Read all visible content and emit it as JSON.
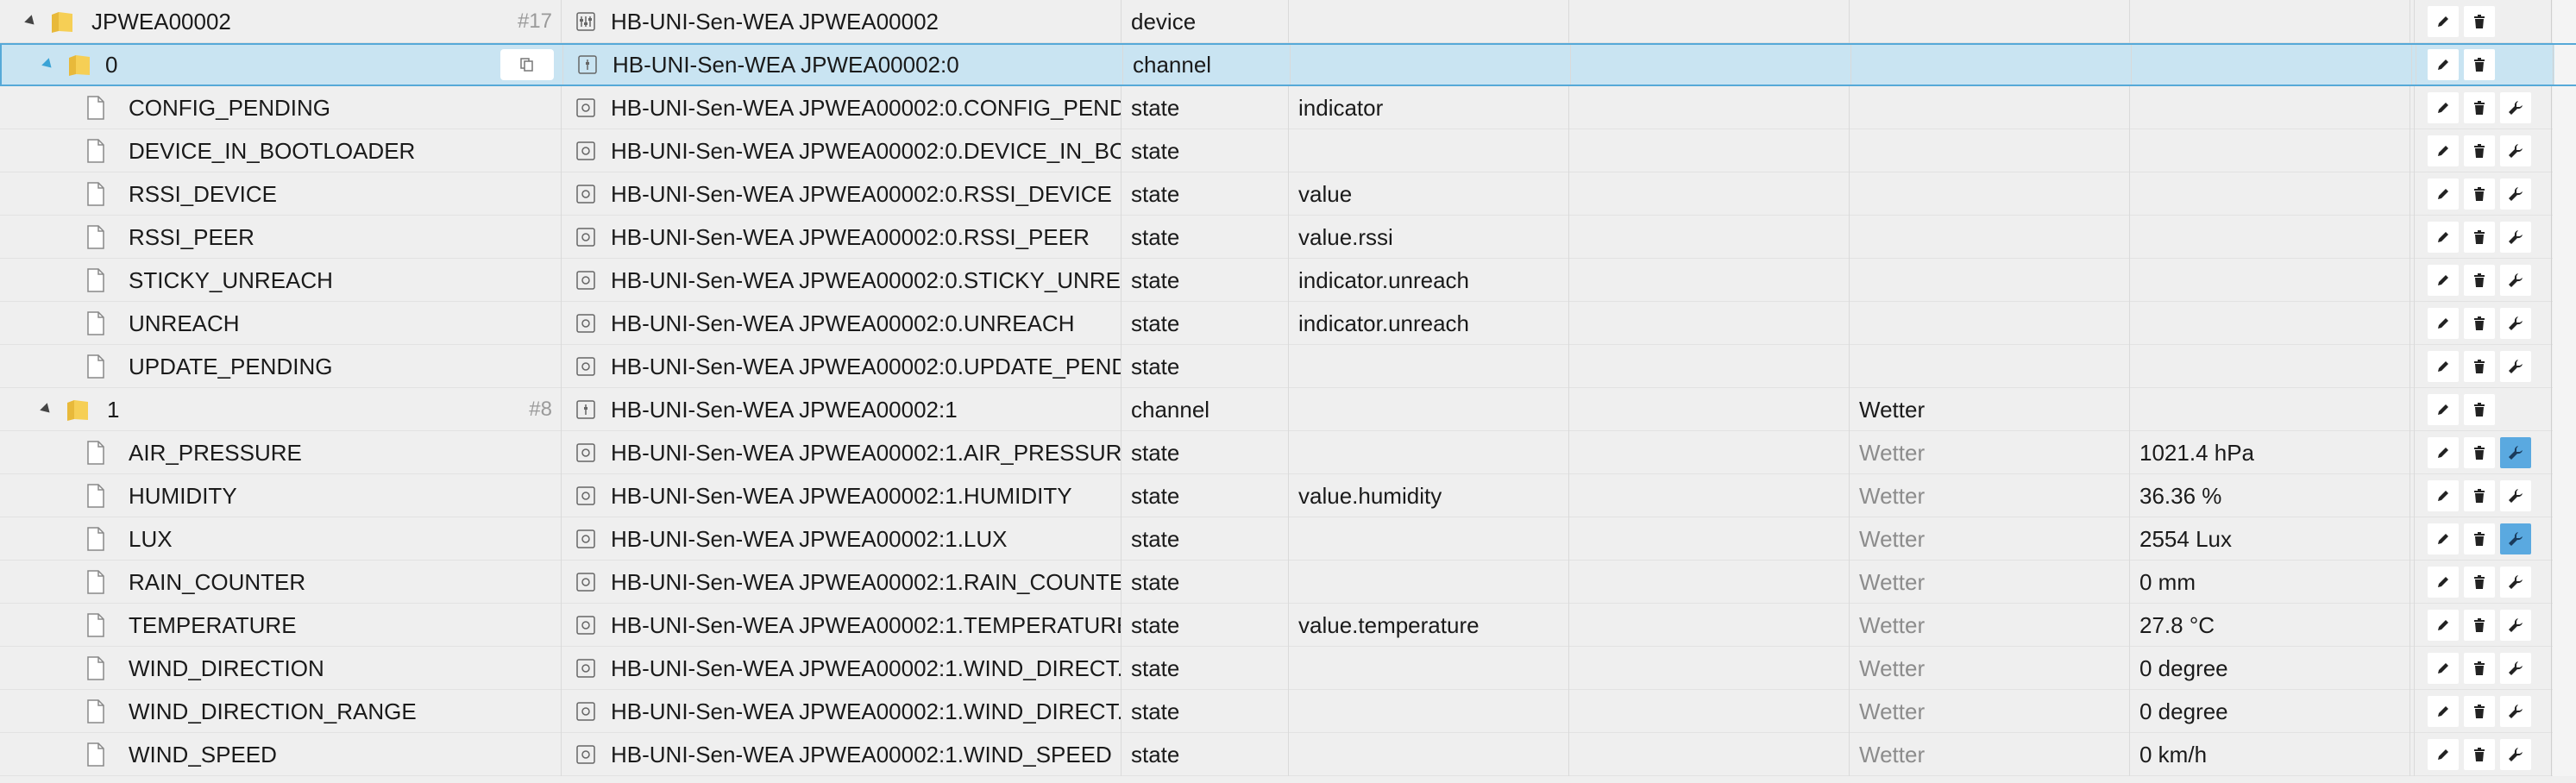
{
  "rows": [
    {
      "name": "JPWEA00002",
      "count": "#17",
      "title": "HB-UNI-Sen-WEA JPWEA00002",
      "type": "device",
      "role": "",
      "function": "",
      "value": ""
    },
    {
      "name": "0",
      "count": "",
      "title": "HB-UNI-Sen-WEA JPWEA00002:0",
      "type": "channel",
      "role": "",
      "function": "",
      "value": ""
    },
    {
      "name": "CONFIG_PENDING",
      "count": "",
      "title": "HB-UNI-Sen-WEA JPWEA00002:0.CONFIG_PEND...",
      "type": "state",
      "role": "indicator",
      "function": "",
      "value": ""
    },
    {
      "name": "DEVICE_IN_BOOTLOADER",
      "count": "",
      "title": "HB-UNI-Sen-WEA JPWEA00002:0.DEVICE_IN_BO...",
      "type": "state",
      "role": "",
      "function": "",
      "value": ""
    },
    {
      "name": "RSSI_DEVICE",
      "count": "",
      "title": "HB-UNI-Sen-WEA JPWEA00002:0.RSSI_DEVICE",
      "type": "state",
      "role": "value",
      "function": "",
      "value": ""
    },
    {
      "name": "RSSI_PEER",
      "count": "",
      "title": "HB-UNI-Sen-WEA JPWEA00002:0.RSSI_PEER",
      "type": "state",
      "role": "value.rssi",
      "function": "",
      "value": ""
    },
    {
      "name": "STICKY_UNREACH",
      "count": "",
      "title": "HB-UNI-Sen-WEA JPWEA00002:0.STICKY_UNRE...",
      "type": "state",
      "role": "indicator.unreach",
      "function": "",
      "value": ""
    },
    {
      "name": "UNREACH",
      "count": "",
      "title": "HB-UNI-Sen-WEA JPWEA00002:0.UNREACH",
      "type": "state",
      "role": "indicator.unreach",
      "function": "",
      "value": ""
    },
    {
      "name": "UPDATE_PENDING",
      "count": "",
      "title": "HB-UNI-Sen-WEA JPWEA00002:0.UPDATE_PEND...",
      "type": "state",
      "role": "",
      "function": "",
      "value": ""
    },
    {
      "name": "1",
      "count": "#8",
      "title": "HB-UNI-Sen-WEA JPWEA00002:1",
      "type": "channel",
      "role": "",
      "function": "Wetter",
      "value": ""
    },
    {
      "name": "AIR_PRESSURE",
      "count": "",
      "title": "HB-UNI-Sen-WEA JPWEA00002:1.AIR_PRESSURE",
      "type": "state",
      "role": "",
      "function": "Wetter",
      "value": "1021.4 hPa"
    },
    {
      "name": "HUMIDITY",
      "count": "",
      "title": "HB-UNI-Sen-WEA JPWEA00002:1.HUMIDITY",
      "type": "state",
      "role": "value.humidity",
      "function": "Wetter",
      "value": "36.36 %"
    },
    {
      "name": "LUX",
      "count": "",
      "title": "HB-UNI-Sen-WEA JPWEA00002:1.LUX",
      "type": "state",
      "role": "",
      "function": "Wetter",
      "value": "2554 Lux"
    },
    {
      "name": "RAIN_COUNTER",
      "count": "",
      "title": "HB-UNI-Sen-WEA JPWEA00002:1.RAIN_COUNTER",
      "type": "state",
      "role": "",
      "function": "Wetter",
      "value": "0 mm"
    },
    {
      "name": "TEMPERATURE",
      "count": "",
      "title": "HB-UNI-Sen-WEA JPWEA00002:1.TEMPERATURE",
      "type": "state",
      "role": "value.temperature",
      "function": "Wetter",
      "value": "27.8 °C"
    },
    {
      "name": "WIND_DIRECTION",
      "count": "",
      "title": "HB-UNI-Sen-WEA JPWEA00002:1.WIND_DIRECT...",
      "type": "state",
      "role": "",
      "function": "Wetter",
      "value": "0 degree"
    },
    {
      "name": "WIND_DIRECTION_RANGE",
      "count": "",
      "title": "HB-UNI-Sen-WEA JPWEA00002:1.WIND_DIRECT...",
      "type": "state",
      "role": "",
      "function": "Wetter",
      "value": "0 degree"
    },
    {
      "name": "WIND_SPEED",
      "count": "",
      "title": "HB-UNI-Sen-WEA JPWEA00002:1.WIND_SPEED",
      "type": "state",
      "role": "",
      "function": "Wetter",
      "value": "0 km/h"
    }
  ],
  "icons": {
    "folder": "folder-icon",
    "file": "file-icon",
    "device_type": "device-type-icon",
    "channel_type": "channel-type-icon",
    "state_type": "state-type-icon",
    "edit": "pencil-icon",
    "delete": "trash-icon",
    "custom": "wrench-icon",
    "copy": "copy-icon"
  },
  "colors": {
    "selected_row": "#c9e4f2",
    "selected_border": "#56a9d8",
    "active_wrench": "#5aa9e0",
    "function_muted": "#8c8c8c"
  }
}
